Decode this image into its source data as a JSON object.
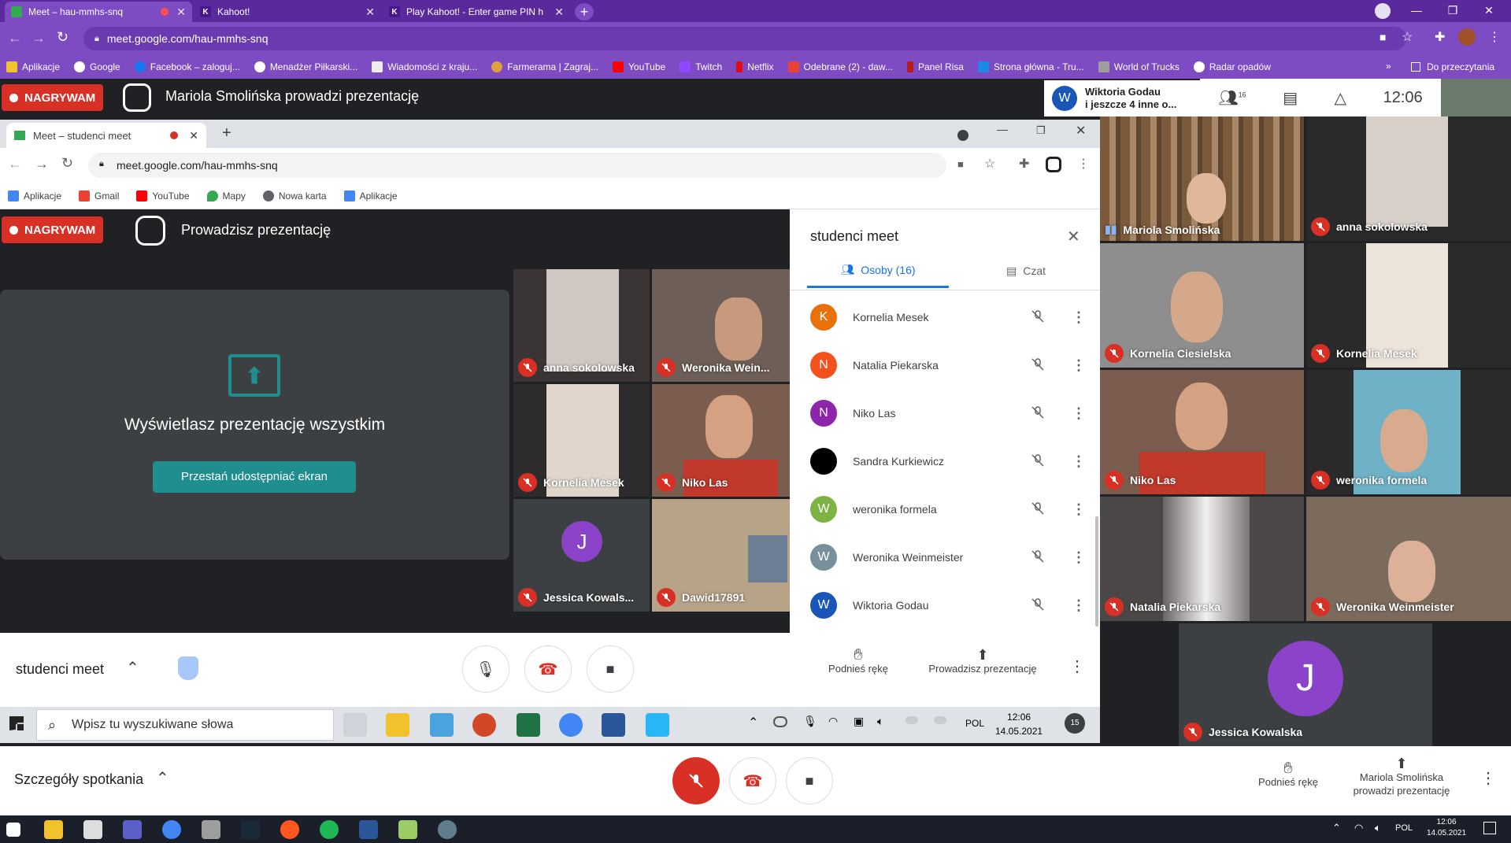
{
  "browser": {
    "tabs": [
      {
        "label": "Meet – hau-mmhs-snq"
      },
      {
        "label": "Kahoot!"
      },
      {
        "label": "Play Kahoot! - Enter game PIN h"
      }
    ],
    "url": "meet.google.com/hau-mmhs-snq",
    "bookmarks": [
      "Aplikacje",
      "Google",
      "Facebook – zaloguj...",
      "Menadżer Piłkarski...",
      "Wiadomości z kraju...",
      "Farmerama | Zagraj...",
      "YouTube",
      "Twitch",
      "Netflix",
      "Odebrane (2) - daw...",
      "Panel Risa",
      "Strona główna - Tru...",
      "World of Trucks",
      "Radar opadów"
    ],
    "reading_list": "Do przeczytania",
    "overflow": "»"
  },
  "outer_meet": {
    "recording": "NAGRYWAM",
    "presenting": "Mariola Smolińska prowadzi prezentację",
    "presenter_chip": {
      "avatar": "W",
      "line1": "Wiktoria Godau",
      "line2": "i jeszcze 4 inne o..."
    },
    "people_count": "16",
    "time": "12:06",
    "meeting_details": "Szczegóły spotkania",
    "raise_hand": "Podnieś rękę",
    "presenting_short": "Mariola Smolińska prowadzi prezentację"
  },
  "right_grid": [
    {
      "name": "Mariola Smolińska"
    },
    {
      "name": "anna sokolowska"
    },
    {
      "name": "Kornelia Ciesielska"
    },
    {
      "name": "Kornelia Mesek"
    },
    {
      "name": "Niko Las"
    },
    {
      "name": "weronika formela"
    },
    {
      "name": "Natalia Piekarska"
    },
    {
      "name": "Weronika Weinmeister"
    },
    {
      "name": "Jessica Kowalska",
      "avatar": "J"
    }
  ],
  "inner": {
    "tab": "Meet – studenci meet",
    "url": "meet.google.com/hau-mmhs-snq",
    "bookmarks": [
      "Aplikacje",
      "Gmail",
      "YouTube",
      "Mapy",
      "Nowa karta",
      "Aplikacje"
    ],
    "recording": "NAGRYWAM",
    "presenting": "Prowadzisz prezentację",
    "present_msg": "Wyświetlasz prezentację wszystkim",
    "stop_share": "Przestań udostępniać ekran",
    "tiles": [
      {
        "name": "anna sokolowska"
      },
      {
        "name": "Weronika Wein..."
      },
      {
        "name": "Kornelia Mesek"
      },
      {
        "name": "Niko Las"
      },
      {
        "name": "Jessica Kowals...",
        "avatar": "J"
      },
      {
        "name": "Dawid17891"
      }
    ],
    "panel": {
      "title": "studenci meet",
      "people_tab": "Osoby (16)",
      "chat_tab": "Czat",
      "people": [
        {
          "initial": "K",
          "name": "Kornelia Mesek",
          "color": "#e8710a"
        },
        {
          "initial": "N",
          "name": "Natalia Piekarska",
          "color": "#f4511e"
        },
        {
          "initial": "N",
          "name": "Niko Las",
          "color": "#8e24aa"
        },
        {
          "initial": "",
          "name": "Sandra Kurkiewicz",
          "color": "#000000"
        },
        {
          "initial": "W",
          "name": "weronika formela",
          "color": "#7cb342"
        },
        {
          "initial": "W",
          "name": "Weronika Weinmeister",
          "color": "#78909c"
        },
        {
          "initial": "W",
          "name": "Wiktoria Godau",
          "color": "#1a56b8"
        }
      ]
    },
    "meeting_name": "studenci meet",
    "raise_hand": "Podnieś rękę",
    "present": "Prowadzisz prezentację",
    "search_placeholder": "Wpisz tu wyszukiwane słowa",
    "lang": "POL",
    "clock_time": "12:06",
    "clock_date": "14.05.2021",
    "notif": "15"
  },
  "taskbar": {
    "lang": "POL",
    "time": "12:06",
    "date": "14.05.2021"
  },
  "colors": {
    "meet_bg": "#202124",
    "red": "#d93025",
    "teal": "#1e8e8e",
    "purple_chrome": "#7d4bc2"
  }
}
